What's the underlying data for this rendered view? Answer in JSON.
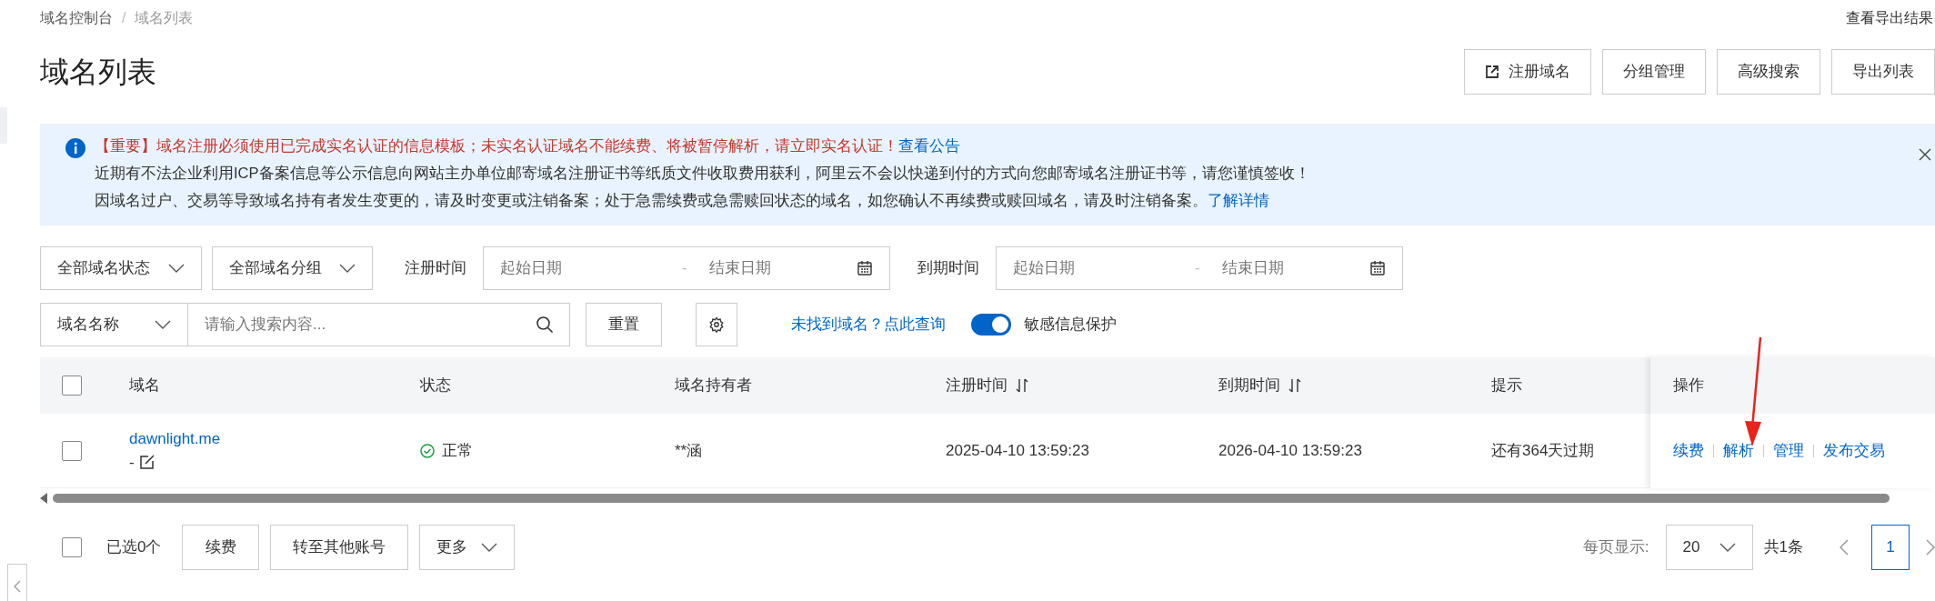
{
  "breadcrumb_separator": "/",
  "breadcrumb": [
    {
      "label": "域名控制台",
      "current": false
    },
    {
      "label": "域名列表",
      "current": true
    }
  ],
  "top_link": "查看导出结果",
  "title": "域名列表",
  "header_buttons": [
    {
      "label": "注册域名"
    },
    {
      "label": "分组管理"
    },
    {
      "label": "高级搜索"
    },
    {
      "label": "导出列表"
    }
  ],
  "notice": {
    "lines": [
      {
        "text": "【重要】域名注册必须使用已完成实名认证的信息模板；未实名认证域名不能续费、将被暂停解析，请立即实名认证！",
        "important": true,
        "link": "查看公告"
      },
      {
        "text": "近期有不法企业利用ICP备案信息等公示信息向网站主办单位邮寄域名注册证书等纸质文件收取费用获利，阿里云不会以快递到付的方式向您邮寄域名注册证书等，请您谨慎签收！",
        "important": false
      },
      {
        "text": "因域名过户、交易等导致域名持有者发生变更的，请及时变更或注销备案；处于急需续费或急需赎回状态的域名，如您确认不再续费或赎回域名，请及时注销备案。",
        "important": false,
        "link": "了解详情"
      }
    ]
  },
  "filters": {
    "status_select": "全部域名状态",
    "group_select": "全部域名分组",
    "ranges": [
      {
        "label": "注册时间",
        "start_placeholder": "起始日期",
        "separator": "-",
        "end_placeholder": "结束日期"
      },
      {
        "label": "到期时间",
        "start_placeholder": "起始日期",
        "separator": "-",
        "end_placeholder": "结束日期"
      }
    ],
    "field_select": "域名名称",
    "search_placeholder": "请输入搜索内容...",
    "reset": "重置",
    "not_found_link": "未找到域名？点此查询",
    "privacy_toggle": {
      "label": "敏感信息保护",
      "on": true
    }
  },
  "table": {
    "header_checked": false,
    "columns": [
      {
        "label": "域名",
        "sortable": false
      },
      {
        "label": "状态",
        "sortable": false
      },
      {
        "label": "域名持有者",
        "sortable": false
      },
      {
        "label": "注册时间",
        "sortable": true
      },
      {
        "label": "到期时间",
        "sortable": true
      },
      {
        "label": "提示",
        "sortable": false
      }
    ],
    "actions_header": "操作",
    "rows": [
      {
        "checked": false,
        "domain": "dawnlight.me",
        "group": "-",
        "status": "正常",
        "holder": "**涵",
        "registered": "2025-04-10 13:59:23",
        "expires": "2026-04-10 13:59:23",
        "hint": "还有364天过期",
        "actions": [
          "续费",
          "解析",
          "管理",
          "发布交易"
        ]
      }
    ]
  },
  "footer": {
    "checked": false,
    "selected_count": "已选0个",
    "buttons": [
      "续费",
      "转至其他账号"
    ],
    "more": "更多",
    "page_size_label": "每页显示:",
    "page_size": "20",
    "total": "共1条",
    "pages": [
      {
        "label": "1",
        "selected": true
      }
    ]
  }
}
